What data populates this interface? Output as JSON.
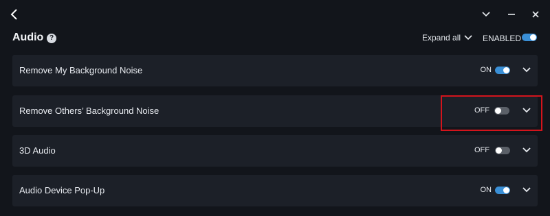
{
  "colors": {
    "background": "#12151b",
    "card": "#1c2028",
    "toggle_on": "#3a8fd6",
    "toggle_off": "#5b6068",
    "highlight": "#d4141c"
  },
  "header": {
    "title": "Audio",
    "help_icon": "?",
    "expand_all_label": "Expand all",
    "enabled_label": "ENABLED",
    "enabled_state": true
  },
  "settings": [
    {
      "label": "Remove My Background Noise",
      "state_label": "ON",
      "on": true
    },
    {
      "label": "Remove Others’ Background Noise",
      "state_label": "OFF",
      "on": false
    },
    {
      "label": "3D Audio",
      "state_label": "OFF",
      "on": false
    },
    {
      "label": "Audio Device Pop-Up",
      "state_label": "ON",
      "on": true
    }
  ]
}
